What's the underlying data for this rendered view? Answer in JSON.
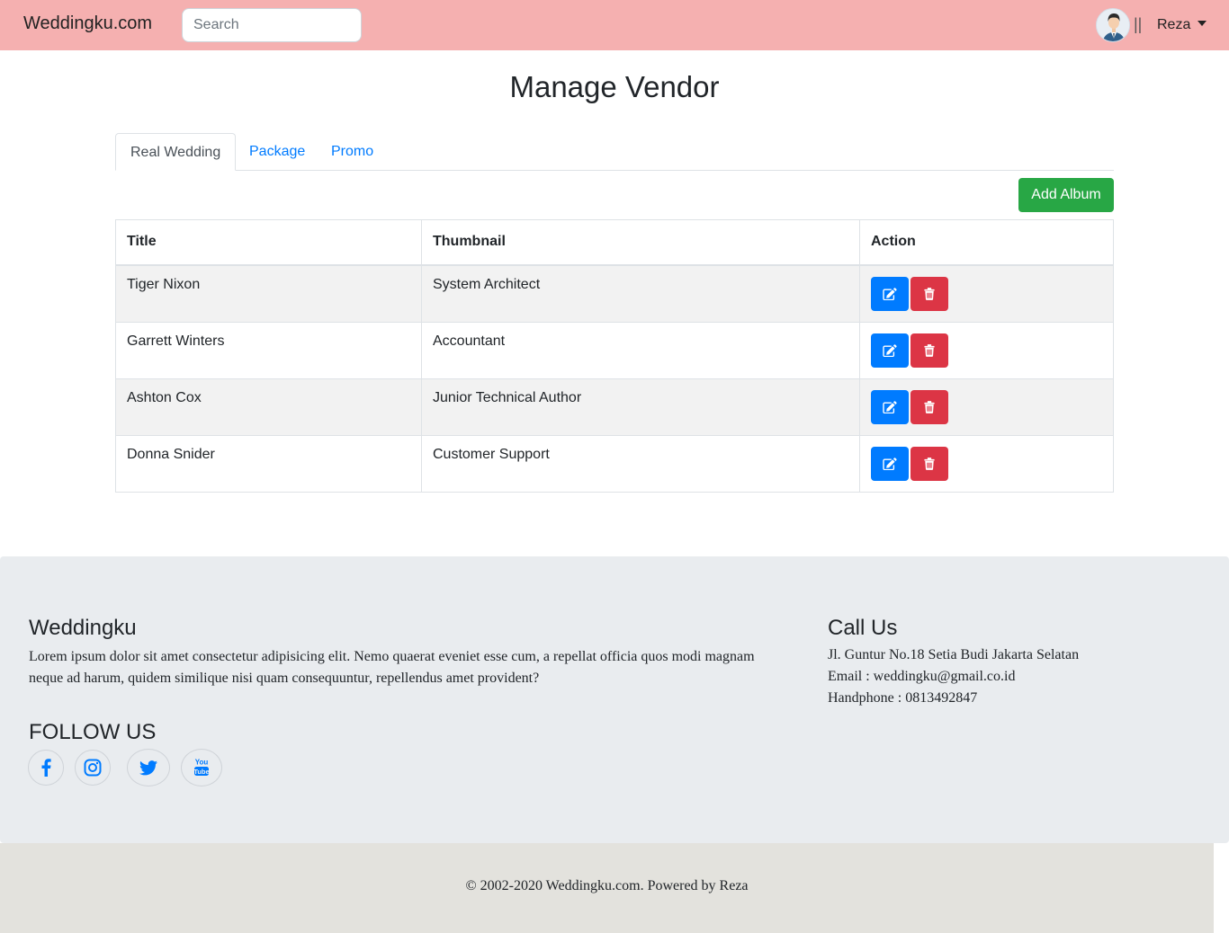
{
  "navbar": {
    "brand": "Weddingku.com",
    "search_placeholder": "Search",
    "separator": "||",
    "user_name": "Reza"
  },
  "page": {
    "title": "Manage Vendor"
  },
  "tabs": [
    {
      "label": "Real Wedding",
      "active": true
    },
    {
      "label": "Package",
      "active": false
    },
    {
      "label": "Promo",
      "active": false
    }
  ],
  "add_button_label": "Add Album",
  "table": {
    "headers": [
      "Title",
      "Thumbnail",
      "Action"
    ],
    "rows": [
      {
        "title": "Tiger Nixon",
        "thumbnail": "System Architect"
      },
      {
        "title": "Garrett Winters",
        "thumbnail": "Accountant"
      },
      {
        "title": "Ashton Cox",
        "thumbnail": "Junior Technical Author"
      },
      {
        "title": "Donna Snider",
        "thumbnail": "Customer Support"
      }
    ]
  },
  "footer": {
    "about_title": "Weddingku",
    "about_text": "Lorem ipsum dolor sit amet consectetur adipisicing elit. Nemo quaerat eveniet esse cum, a repellat officia quos modi magnam neque ad harum, quidem similique nisi quam consequuntur, repellendus amet provident?",
    "follow_title": "FOLLOW US",
    "socials": [
      "facebook-icon",
      "instagram-icon",
      "twitter-icon",
      "youtube-icon"
    ],
    "contact_title": "Call Us",
    "address": "Jl. Guntur No.18 Setia Budi Jakarta Selatan",
    "email": "Email : weddingku@gmail.co.id",
    "phone": "Handphone : 0813492847",
    "copyright": "© 2002-2020 Weddingku.com. Powered by Reza"
  },
  "colors": {
    "navbar_bg": "#f5b0b0",
    "primary": "#007bff",
    "success": "#28a745",
    "danger": "#dc3545",
    "footer_bg": "#e9ecef",
    "bottom_bg": "#e3e2dd"
  }
}
